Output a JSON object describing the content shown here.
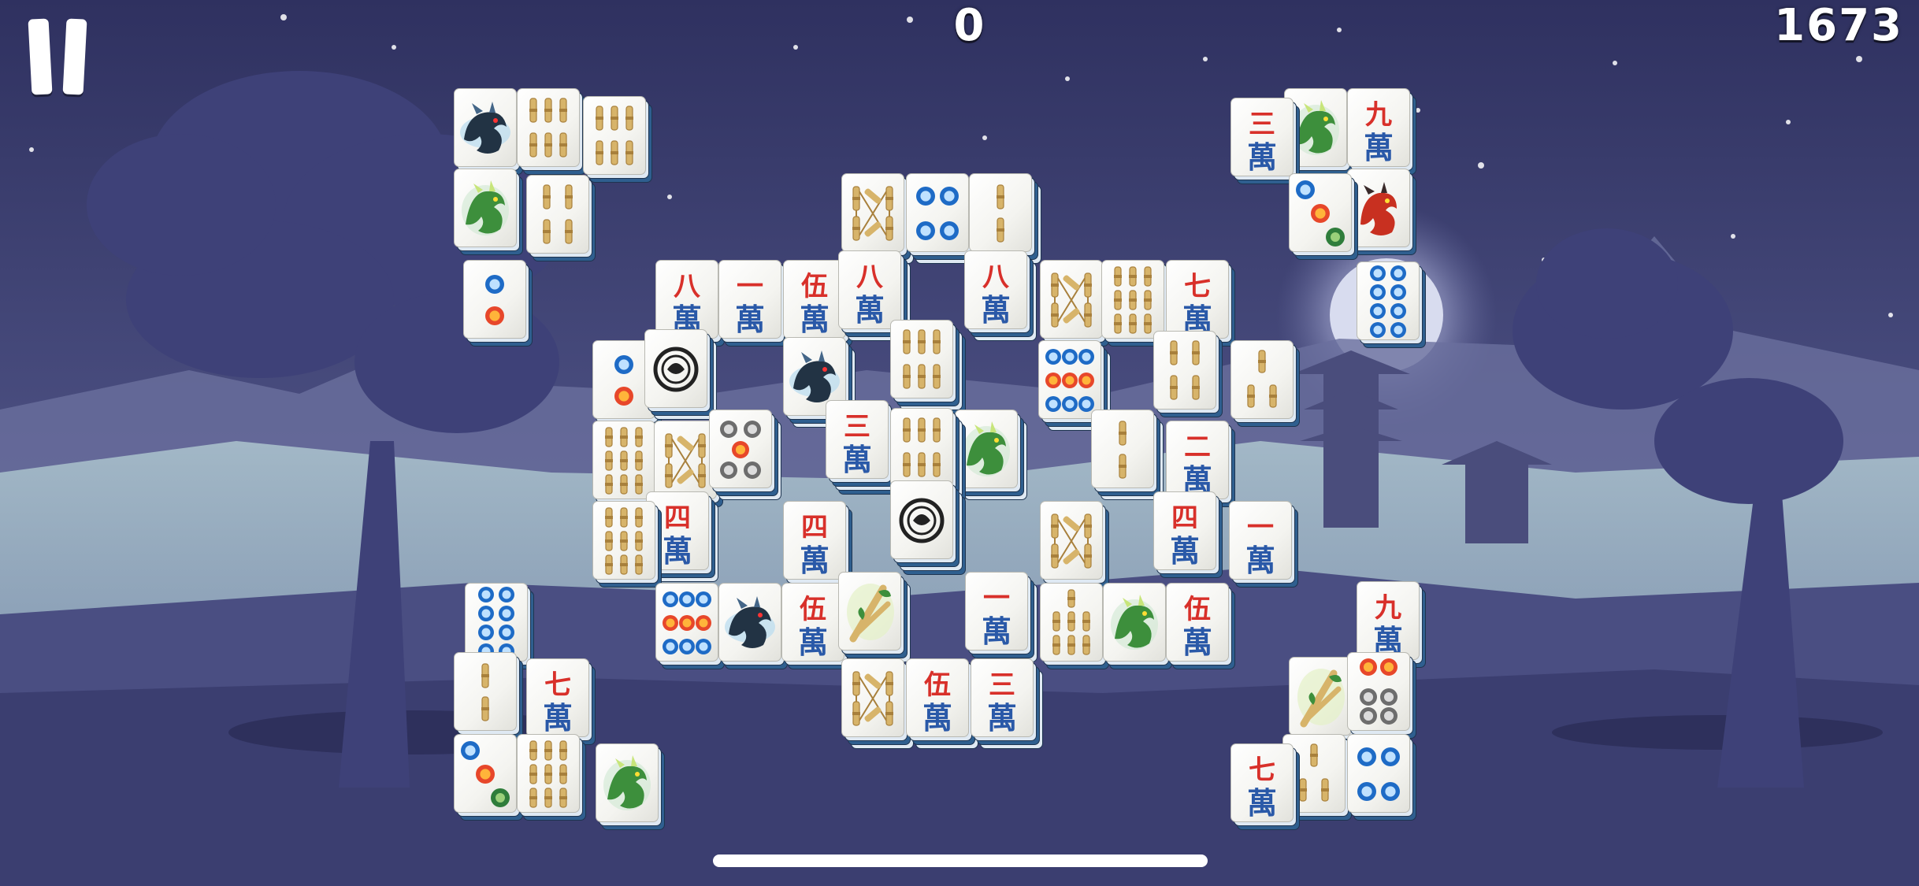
{
  "hud": {
    "move_count": "0",
    "score": "1673"
  },
  "controls": {
    "pause_icon": "pause-icon"
  },
  "tile_glyphs": {
    "one": "一",
    "two": "二",
    "three": "三",
    "four": "四",
    "five": "伍",
    "seven": "七",
    "eight": "八",
    "nine": "九",
    "wan": "萬"
  },
  "tiles": [
    {
      "kind": "dragon-black"
    },
    {
      "kind": "bamboo-6"
    },
    {
      "kind": "bamboo-6"
    },
    {
      "kind": "dragon-green"
    },
    {
      "kind": "bamboo-4"
    },
    {
      "kind": "circle-2"
    },
    {
      "kind": "bamboo-8"
    },
    {
      "kind": "circle-4"
    },
    {
      "kind": "bamboo-2"
    },
    {
      "kind": "char",
      "num": "eight"
    },
    {
      "kind": "char",
      "num": "one"
    },
    {
      "kind": "char",
      "num": "five"
    },
    {
      "kind": "char",
      "num": "eight"
    },
    {
      "kind": "char",
      "num": "eight"
    },
    {
      "kind": "bamboo-8"
    },
    {
      "kind": "bamboo-9"
    },
    {
      "kind": "char",
      "num": "seven"
    },
    {
      "kind": "circle-2"
    },
    {
      "kind": "dragon-white"
    },
    {
      "kind": "dragon-black"
    },
    {
      "kind": "bamboo-6"
    },
    {
      "kind": "bamboo-4"
    },
    {
      "kind": "bamboo-3"
    },
    {
      "kind": "char",
      "num": "three"
    },
    {
      "kind": "bamboo-9"
    },
    {
      "kind": "bamboo-8"
    },
    {
      "kind": "circle-5"
    },
    {
      "kind": "bamboo-6"
    },
    {
      "kind": "dragon-green"
    },
    {
      "kind": "circle-9"
    },
    {
      "kind": "bamboo-2"
    },
    {
      "kind": "char",
      "num": "two"
    },
    {
      "kind": "bamboo-9"
    },
    {
      "kind": "char",
      "num": "four"
    },
    {
      "kind": "char",
      "num": "four"
    },
    {
      "kind": "dragon-white"
    },
    {
      "kind": "bamboo-8"
    },
    {
      "kind": "char",
      "num": "four"
    },
    {
      "kind": "char",
      "num": "one"
    },
    {
      "kind": "circle-9"
    },
    {
      "kind": "dragon-black"
    },
    {
      "kind": "char",
      "num": "five"
    },
    {
      "kind": "flower"
    },
    {
      "kind": "char",
      "num": "one"
    },
    {
      "kind": "bamboo-7"
    },
    {
      "kind": "dragon-green"
    },
    {
      "kind": "char",
      "num": "five"
    },
    {
      "kind": "bamboo-8"
    },
    {
      "kind": "char",
      "num": "five"
    },
    {
      "kind": "char",
      "num": "three"
    },
    {
      "kind": "circle-8"
    },
    {
      "kind": "bamboo-2"
    },
    {
      "kind": "char",
      "num": "seven"
    },
    {
      "kind": "circle-3"
    },
    {
      "kind": "bamboo-9"
    },
    {
      "kind": "dragon-green"
    },
    {
      "kind": "char",
      "num": "three"
    },
    {
      "kind": "dragon-green"
    },
    {
      "kind": "char",
      "num": "nine"
    },
    {
      "kind": "circle-3"
    },
    {
      "kind": "dragon-red"
    },
    {
      "kind": "circle-8"
    },
    {
      "kind": "char",
      "num": "nine"
    },
    {
      "kind": "flower"
    },
    {
      "kind": "circle-6"
    },
    {
      "kind": "char",
      "num": "seven"
    },
    {
      "kind": "bamboo-3"
    },
    {
      "kind": "circle-4"
    },
    {
      "kind": "bamboo-6"
    }
  ]
}
